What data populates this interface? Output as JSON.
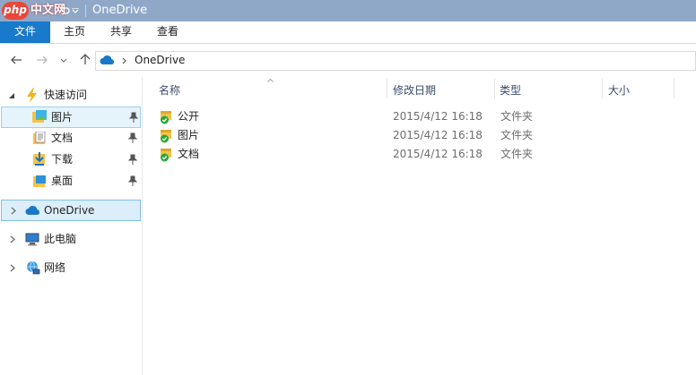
{
  "watermark": {
    "brand": "php",
    "brand_cn": "中文网"
  },
  "window": {
    "title": "OneDrive"
  },
  "ribbon": {
    "tabs": [
      "文件",
      "主页",
      "共享",
      "查看"
    ]
  },
  "address": {
    "path": [
      "OneDrive"
    ]
  },
  "nav": {
    "quick_access_label": "快速访问",
    "quick_items": [
      {
        "label": "图片",
        "icon": "pictures-folder-icon",
        "pinned": true,
        "selected": true
      },
      {
        "label": "文档",
        "icon": "documents-folder-icon",
        "pinned": true
      },
      {
        "label": "下载",
        "icon": "downloads-folder-icon",
        "pinned": true
      },
      {
        "label": "桌面",
        "icon": "desktop-folder-icon",
        "pinned": true
      }
    ],
    "onedrive_label": "OneDrive",
    "this_pc_label": "此电脑",
    "network_label": "网络"
  },
  "columns": {
    "name": "名称",
    "modified": "修改日期",
    "type": "类型",
    "size": "大小"
  },
  "files": [
    {
      "name": "公开",
      "modified": "2015/4/12 16:18",
      "type": "文件夹",
      "sync": "synced"
    },
    {
      "name": "图片",
      "modified": "2015/4/12 16:18",
      "type": "文件夹",
      "sync": "synced"
    },
    {
      "name": "文档",
      "modified": "2015/4/12 16:18",
      "type": "文件夹",
      "sync": "synced"
    }
  ],
  "colors": {
    "accent": "#1979ca",
    "titlebar": "#8fa8c8",
    "selection": "#e5f3fb",
    "sync_green": "#2aa836",
    "folder": "#f3c34b"
  }
}
